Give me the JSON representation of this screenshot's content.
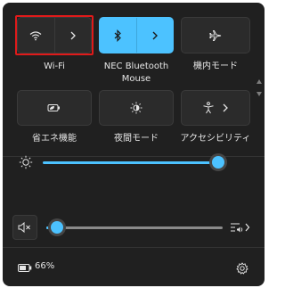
{
  "quick_settings": {
    "tiles": [
      {
        "label": "Wi-Fi",
        "icon": "wifi-icon",
        "state": "off",
        "expandable": true
      },
      {
        "label": "NEC Bluetooth Mouse",
        "icon": "bluetooth-icon",
        "state": "on",
        "expandable": true
      },
      {
        "label": "機内モード",
        "icon": "airplane-icon",
        "state": "off",
        "expandable": false
      },
      {
        "label": "省エネ機能",
        "icon": "energy-saver-icon",
        "state": "off",
        "expandable": false
      },
      {
        "label": "夜間モード",
        "icon": "night-light-icon",
        "state": "off",
        "expandable": false
      },
      {
        "label": "アクセシビリティ",
        "icon": "accessibility-icon",
        "state": "off",
        "expandable": true
      }
    ]
  },
  "brightness": {
    "icon": "brightness-icon",
    "level": 0.98
  },
  "volume": {
    "icon": "speaker-muted-icon",
    "level": 0.05,
    "output_icon": "audio-output-icon"
  },
  "footer": {
    "battery_icon": "battery-icon",
    "battery_text": "66%",
    "settings_icon": "gear-icon"
  },
  "colors": {
    "panel": "#202020",
    "tile": "#2b2b2b",
    "accent": "#4cc2ff",
    "highlight": "#e01a1a"
  }
}
